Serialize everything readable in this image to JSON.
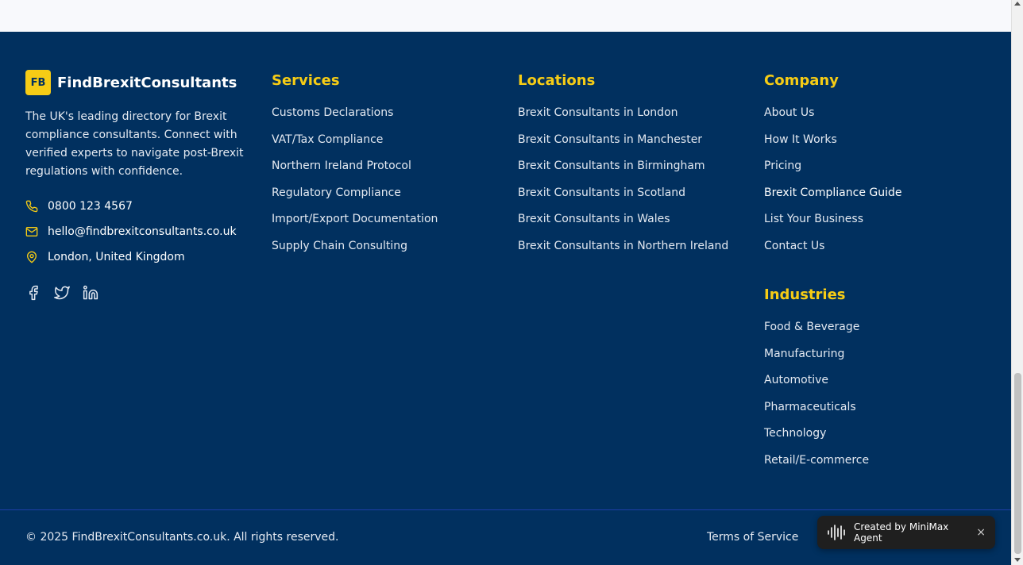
{
  "brand": {
    "badge": "FB",
    "name": "FindBrexitConsultants",
    "description": "The UK's leading directory for Brexit compliance consultants. Connect with verified experts to navigate post-Brexit regulations with confidence."
  },
  "contact": {
    "phone": "0800 123 4567",
    "email": "hello@findbrexitconsultants.co.uk",
    "location": "London, United Kingdom"
  },
  "socials": [
    "facebook-icon",
    "twitter-icon",
    "linkedin-icon"
  ],
  "services": {
    "heading": "Services",
    "items": [
      "Customs Declarations",
      "VAT/Tax Compliance",
      "Northern Ireland Protocol",
      "Regulatory Compliance",
      "Import/Export Documentation",
      "Supply Chain Consulting"
    ]
  },
  "locations": {
    "heading": "Locations",
    "items": [
      "Brexit Consultants in London",
      "Brexit Consultants in Manchester",
      "Brexit Consultants in Birmingham",
      "Brexit Consultants in Scotland",
      "Brexit Consultants in Wales",
      "Brexit Consultants in Northern Ireland"
    ]
  },
  "company": {
    "heading": "Company",
    "items": [
      "About Us",
      "How It Works",
      "Pricing",
      "Brexit Compliance Guide",
      "List Your Business",
      "Contact Us"
    ]
  },
  "industries": {
    "heading": "Industries",
    "items": [
      "Food & Beverage",
      "Manufacturing",
      "Automotive",
      "Pharmaceuticals",
      "Technology",
      "Retail/E-commerce"
    ]
  },
  "bottom": {
    "copyright": "© 2025 FindBrexitConsultants.co.uk. All rights reserved.",
    "terms": "Terms of Service"
  },
  "badge_overlay": {
    "text": "Created by MiniMax Agent",
    "close": "×"
  },
  "colors": {
    "footer_bg": "#01305f",
    "accent": "#f6cc15"
  }
}
